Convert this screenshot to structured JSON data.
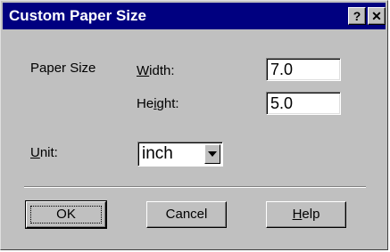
{
  "window": {
    "title": "Custom Paper Size",
    "help_glyph": "?",
    "close_glyph": "✕"
  },
  "paper_size": {
    "group_label": "Paper Size",
    "width_label_pre": "",
    "width_label_key": "W",
    "width_label_post": "idth:",
    "width_value": "7.0",
    "height_label_pre": "He",
    "height_label_key": "i",
    "height_label_post": "ght:",
    "height_value": "5.0"
  },
  "unit": {
    "label_key": "U",
    "label_post": "nit:",
    "selected": "inch"
  },
  "buttons": {
    "ok": "OK",
    "cancel": "Cancel",
    "help_key": "H",
    "help_post": "elp"
  },
  "colors": {
    "titlebar": "#000080",
    "face": "#c0c0c0"
  }
}
